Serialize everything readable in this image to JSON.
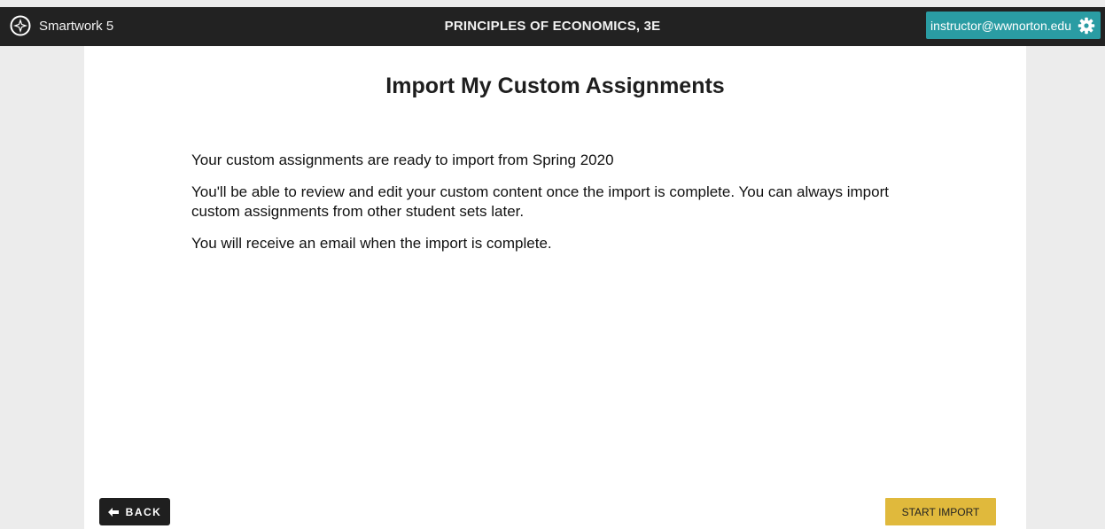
{
  "header": {
    "app_name": "Smartwork 5",
    "course_title": "PRINCIPLES OF ECONOMICS, 3E",
    "user_email": "instructor@wwnorton.edu",
    "logo_icon": "compass-logo-icon",
    "settings_icon": "gear-icon"
  },
  "main": {
    "title": "Import My Custom Assignments",
    "paragraphs": [
      "Your custom assignments are ready to import from Spring 2020",
      "You'll be able to review and edit your custom content once the import is complete. You can always import custom assignments from other student sets later.",
      "You will receive an email when the import is complete."
    ]
  },
  "footer": {
    "back_label": "BACK",
    "back_icon": "arrow-left-icon",
    "start_label": "START IMPORT"
  },
  "colors": {
    "topbar": "#222222",
    "user_button": "#2a9ca3",
    "start_button": "#e0b93c",
    "back_button": "#1f1f1f",
    "page_background": "#ececec"
  }
}
